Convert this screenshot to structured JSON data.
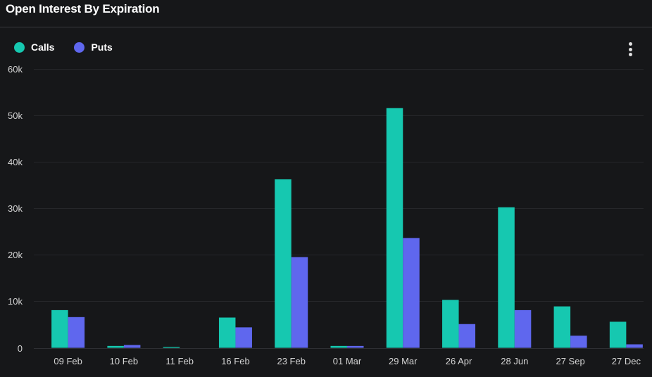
{
  "header": {
    "title": "Open Interest By Expiration"
  },
  "legend": [
    {
      "label": "Calls",
      "color": "#16c8b0"
    },
    {
      "label": "Puts",
      "color": "#5f67ee"
    }
  ],
  "menu": {
    "icon": "more-vertical-icon"
  },
  "colors": {
    "background": "#161719",
    "grid": "#26272a",
    "calls": "#16c8b0",
    "puts": "#5f67ee"
  },
  "chart_data": {
    "type": "bar",
    "title": "Open Interest By Expiration",
    "xlabel": "",
    "ylabel": "",
    "categories": [
      "09 Feb",
      "10 Feb",
      "11 Feb",
      "16 Feb",
      "23 Feb",
      "01 Mar",
      "29 Mar",
      "26 Apr",
      "28 Jun",
      "27 Sep",
      "27 Dec"
    ],
    "series": [
      {
        "name": "Calls",
        "color": "#16c8b0",
        "values": [
          8100,
          400,
          200,
          6500,
          36200,
          400,
          51500,
          10300,
          30200,
          8900,
          5600
        ]
      },
      {
        "name": "Puts",
        "color": "#5f67ee",
        "values": [
          6600,
          600,
          0,
          4400,
          19500,
          400,
          23600,
          5100,
          8100,
          2600,
          750
        ]
      }
    ],
    "ylim": [
      0,
      60000
    ],
    "yticks": [
      0,
      10000,
      20000,
      30000,
      40000,
      50000,
      60000
    ],
    "ytick_labels": [
      "0",
      "10k",
      "20k",
      "30k",
      "40k",
      "50k",
      "60k"
    ],
    "grid": true,
    "legend_position": "top-left"
  }
}
